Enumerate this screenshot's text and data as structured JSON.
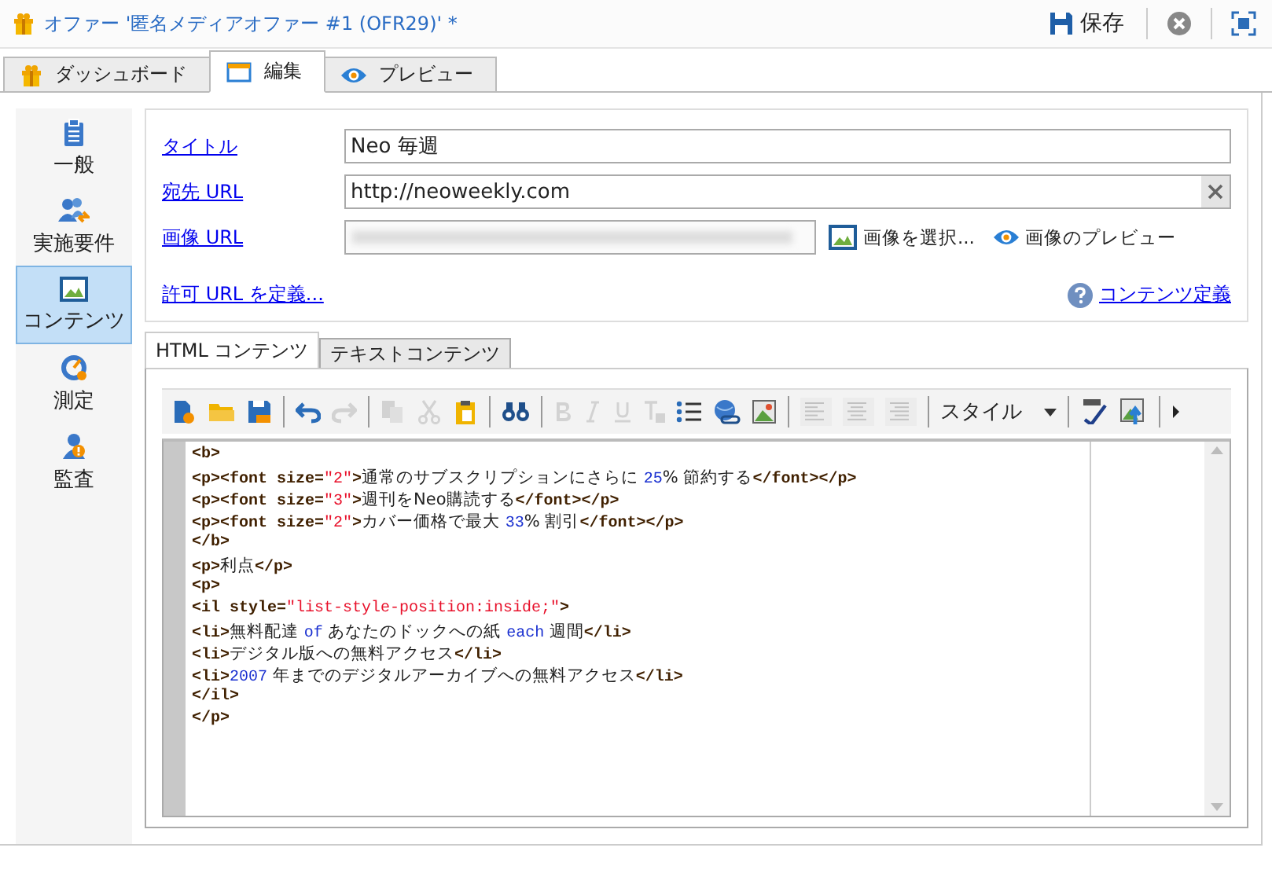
{
  "window": {
    "title": "オファー '匿名メディアオファー #1 (OFR29)' *",
    "save": "保存"
  },
  "tabs": [
    {
      "label": "ダッシュボード",
      "selected": false
    },
    {
      "label": "編集",
      "selected": true
    },
    {
      "label": "プレビュー",
      "selected": false
    }
  ],
  "sidebar": {
    "items": [
      {
        "label": "一般",
        "selected": false
      },
      {
        "label": "実施要件",
        "selected": false
      },
      {
        "label": "コンテンツ",
        "selected": true
      },
      {
        "label": "測定",
        "selected": false
      },
      {
        "label": "監査",
        "selected": false
      }
    ]
  },
  "form": {
    "fields": [
      {
        "label": "タイトル",
        "value": "Neo 毎週",
        "clearable": false
      },
      {
        "label": "宛先 URL",
        "value": "http://neoweekly.com",
        "clearable": true
      },
      {
        "label": "画像 URL",
        "blurred": true
      }
    ],
    "select_image": "画像を選択...",
    "preview_image": "画像のプレビュー",
    "allowed_urls": "許可 URL を定義...",
    "content_definition": "コンテンツ定義"
  },
  "content_tabs": [
    {
      "label": "HTML コンテンツ",
      "selected": true
    },
    {
      "label": "テキストコンテンツ",
      "selected": false
    }
  ],
  "toolbar": [
    {
      "kind": "new",
      "disabled": false
    },
    {
      "kind": "open",
      "disabled": false
    },
    {
      "kind": "save",
      "disabled": false
    },
    {
      "kind": "sep"
    },
    {
      "kind": "undo",
      "disabled": false
    },
    {
      "kind": "redo",
      "disabled": true
    },
    {
      "kind": "sep"
    },
    {
      "kind": "copy",
      "disabled": true
    },
    {
      "kind": "cut",
      "disabled": true
    },
    {
      "kind": "paste",
      "disabled": false
    },
    {
      "kind": "sep"
    },
    {
      "kind": "find",
      "disabled": false
    },
    {
      "kind": "sep"
    },
    {
      "kind": "bold",
      "disabled": true
    },
    {
      "kind": "italic",
      "disabled": true
    },
    {
      "kind": "underline",
      "disabled": true
    },
    {
      "kind": "clearformat",
      "disabled": true
    },
    {
      "kind": "list",
      "disabled": false
    },
    {
      "kind": "link",
      "disabled": false
    },
    {
      "kind": "picture",
      "disabled": false
    },
    {
      "kind": "sep"
    },
    {
      "kind": "alignleft",
      "disabled": true
    },
    {
      "kind": "aligncenter",
      "disabled": true
    },
    {
      "kind": "alignright",
      "disabled": true
    },
    {
      "kind": "sep"
    },
    {
      "kind": "style",
      "label": "スタイル"
    },
    {
      "kind": "sep"
    },
    {
      "kind": "spell",
      "disabled": false
    },
    {
      "kind": "upload",
      "disabled": false
    },
    {
      "kind": "sep"
    },
    {
      "kind": "more"
    }
  ],
  "code_lines": [
    [
      {
        "kind": "tag",
        "text": "<b>"
      }
    ],
    [
      {
        "kind": "tag",
        "text": "<p><font size="
      },
      {
        "kind": "string",
        "text": "\"2\""
      },
      {
        "kind": "tag",
        "text": ">"
      },
      {
        "kind": "text",
        "text": "通常のサブスクリプションにさらに "
      },
      {
        "kind": "number",
        "text": "25"
      },
      {
        "kind": "text",
        "text": "% 節約する"
      },
      {
        "kind": "tag",
        "text": "</font></p>"
      }
    ],
    [
      {
        "kind": "tag",
        "text": "<p><font size="
      },
      {
        "kind": "string",
        "text": "\"3\""
      },
      {
        "kind": "tag",
        "text": ">"
      },
      {
        "kind": "text",
        "text": "週刊をNeo購読する"
      },
      {
        "kind": "tag",
        "text": "</font></p>"
      }
    ],
    [
      {
        "kind": "tag",
        "text": "<p><font size="
      },
      {
        "kind": "string",
        "text": "\"2\""
      },
      {
        "kind": "tag",
        "text": ">"
      },
      {
        "kind": "text",
        "text": "カバー価格で最大 "
      },
      {
        "kind": "number",
        "text": "33"
      },
      {
        "kind": "text",
        "text": "% 割引"
      },
      {
        "kind": "tag",
        "text": "</font></p>"
      }
    ],
    [
      {
        "kind": "tag",
        "text": "</b>"
      }
    ],
    [
      {
        "kind": "tag",
        "text": "<p>"
      },
      {
        "kind": "text",
        "text": "利点"
      },
      {
        "kind": "tag",
        "text": "</p>"
      }
    ],
    [
      {
        "kind": "tag",
        "text": "<p>"
      }
    ],
    [
      {
        "kind": "tag",
        "text": "<il style="
      },
      {
        "kind": "string",
        "text": "\"list-style-position:inside;\""
      },
      {
        "kind": "tag",
        "text": ">"
      }
    ],
    [
      {
        "kind": "tag",
        "text": "<li>"
      },
      {
        "kind": "text",
        "text": "無料配達 "
      },
      {
        "kind": "keyword",
        "text": "of"
      },
      {
        "kind": "text",
        "text": " あなたのドックへの紙 "
      },
      {
        "kind": "keyword",
        "text": "each"
      },
      {
        "kind": "text",
        "text": " 週間"
      },
      {
        "kind": "tag",
        "text": "</li>"
      }
    ],
    [
      {
        "kind": "tag",
        "text": "<li>"
      },
      {
        "kind": "text",
        "text": "デジタル版への無料アクセス"
      },
      {
        "kind": "tag",
        "text": "</li>"
      }
    ],
    [
      {
        "kind": "tag",
        "text": "<li>"
      },
      {
        "kind": "number",
        "text": "2007"
      },
      {
        "kind": "text",
        "text": " 年までのデジタルアーカイブへの無料アクセス"
      },
      {
        "kind": "tag",
        "text": "</li>"
      }
    ],
    [
      {
        "kind": "tag",
        "text": "</il>"
      }
    ],
    [
      {
        "kind": "tag",
        "text": "</p>"
      }
    ]
  ]
}
